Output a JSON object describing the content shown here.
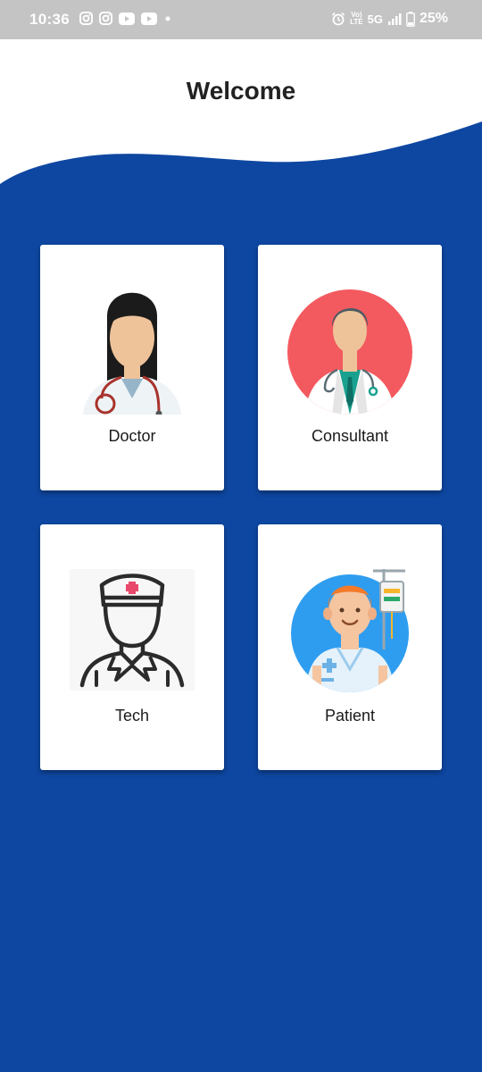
{
  "status_bar": {
    "time": "10:36",
    "left_icons": [
      "instagram-icon",
      "instagram-icon",
      "youtube-icon",
      "youtube-icon",
      "notification-dot-icon"
    ],
    "network_label_top": "Vo)",
    "network_label_bottom": "LTE",
    "network_type": "5G",
    "battery_percent": "25%"
  },
  "header": {
    "title": "Welcome",
    "background": "#ffffff"
  },
  "theme": {
    "background": "#0e47a1",
    "card": "#ffffff"
  },
  "roles": [
    {
      "label": "Doctor",
      "icon": "female-doctor-icon"
    },
    {
      "label": "Consultant",
      "icon": "male-doctor-icon"
    },
    {
      "label": "Tech",
      "icon": "nurse-icon"
    },
    {
      "label": "Patient",
      "icon": "patient-icon"
    }
  ]
}
